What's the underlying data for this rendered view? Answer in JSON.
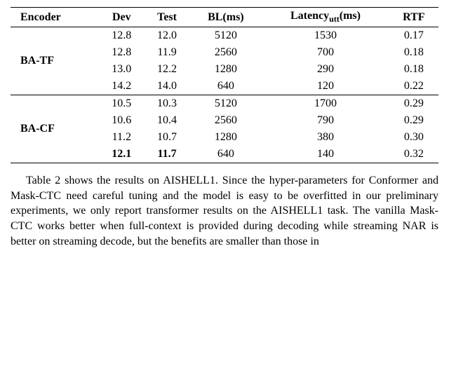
{
  "headers": {
    "encoder": "Encoder",
    "dev": "Dev",
    "test": "Test",
    "bl": "BL(ms)",
    "latency_pre": "Latency",
    "latency_sub": "utt",
    "latency_post": "(ms)",
    "rtf": "RTF"
  },
  "groups": [
    {
      "label": "BA-TF",
      "rows": [
        {
          "dev": "12.8",
          "test": "12.0",
          "bl": "5120",
          "lat": "1530",
          "rtf": "0.17",
          "bold": false
        },
        {
          "dev": "12.8",
          "test": "11.9",
          "bl": "2560",
          "lat": "700",
          "rtf": "0.18",
          "bold": false
        },
        {
          "dev": "13.0",
          "test": "12.2",
          "bl": "1280",
          "lat": "290",
          "rtf": "0.18",
          "bold": false
        },
        {
          "dev": "14.2",
          "test": "14.0",
          "bl": "640",
          "lat": "120",
          "rtf": "0.22",
          "bold": false
        }
      ]
    },
    {
      "label": "BA-CF",
      "rows": [
        {
          "dev": "10.5",
          "test": "10.3",
          "bl": "5120",
          "lat": "1700",
          "rtf": "0.29",
          "bold": false
        },
        {
          "dev": "10.6",
          "test": "10.4",
          "bl": "2560",
          "lat": "790",
          "rtf": "0.29",
          "bold": false
        },
        {
          "dev": "11.2",
          "test": "10.7",
          "bl": "1280",
          "lat": "380",
          "rtf": "0.30",
          "bold": false
        },
        {
          "dev": "12.1",
          "test": "11.7",
          "bl": "640",
          "lat": "140",
          "rtf": "0.32",
          "bold": true
        }
      ]
    }
  ],
  "caption": {
    "text": "Table 2 shows the results on AISHELL1. Since the hyper-parameters for Conformer and Mask-CTC need careful tuning and the model is easy to be overfitted in our preliminary experiments, we only report transformer results on the AISHELL1 task. The vanilla Mask-CTC works better when full-context is provided during decoding while streaming NAR is better on streaming decode, but the benefits are smaller than those in"
  },
  "chart_data": {
    "type": "table",
    "title": "Encoder comparison results",
    "columns": [
      "Encoder",
      "Dev",
      "Test",
      "BL(ms)",
      "Latency_utt(ms)",
      "RTF"
    ],
    "rows": [
      [
        "BA-TF",
        12.8,
        12.0,
        5120,
        1530,
        0.17
      ],
      [
        "BA-TF",
        12.8,
        11.9,
        2560,
        700,
        0.18
      ],
      [
        "BA-TF",
        13.0,
        12.2,
        1280,
        290,
        0.18
      ],
      [
        "BA-TF",
        14.2,
        14.0,
        640,
        120,
        0.22
      ],
      [
        "BA-CF",
        10.5,
        10.3,
        5120,
        1700,
        0.29
      ],
      [
        "BA-CF",
        10.6,
        10.4,
        2560,
        790,
        0.29
      ],
      [
        "BA-CF",
        11.2,
        10.7,
        1280,
        380,
        0.3
      ],
      [
        "BA-CF",
        12.1,
        11.7,
        640,
        140,
        0.32
      ]
    ]
  }
}
